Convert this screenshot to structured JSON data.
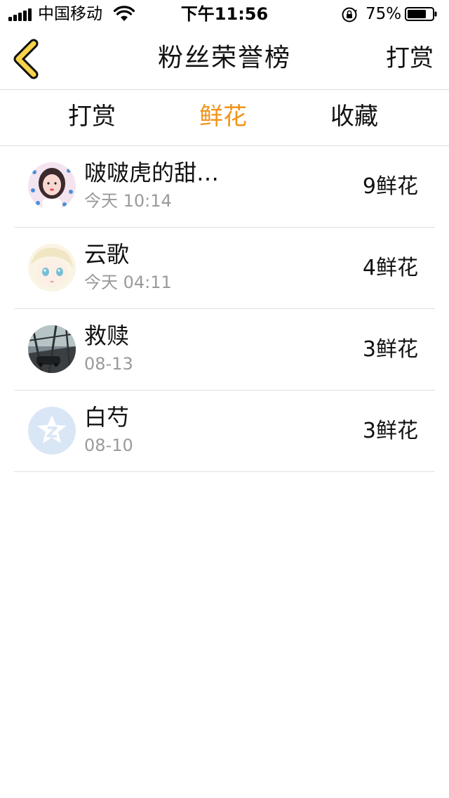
{
  "status_bar": {
    "carrier": "中国移动",
    "time": "下午11:56",
    "battery_percent": "75%",
    "battery_level": 0.75,
    "icons": [
      "signal-icon",
      "wifi-icon",
      "orientation-lock-icon",
      "battery-icon"
    ]
  },
  "nav": {
    "back_icon": "chevron-left-icon",
    "title": "粉丝荣誉榜",
    "action_label": "打赏"
  },
  "tabs": [
    {
      "label": "打赏",
      "active": false
    },
    {
      "label": "鲜花",
      "active": true
    },
    {
      "label": "收藏",
      "active": false
    }
  ],
  "fans": [
    {
      "name": "啵啵虎的甜…",
      "time": "今天 10:14",
      "count": "9鲜花"
    },
    {
      "name": "云歌",
      "time": "今天 04:11",
      "count": "4鲜花"
    },
    {
      "name": "救赎",
      "time": "08-13",
      "count": "3鲜花"
    },
    {
      "name": "白芍",
      "time": "08-10",
      "count": "3鲜花"
    }
  ],
  "colors": {
    "accent": "#f29418",
    "back_icon_fill": "#f7d24a",
    "divider": "#dcdcdc",
    "secondary_text": "#9a9a9a"
  }
}
